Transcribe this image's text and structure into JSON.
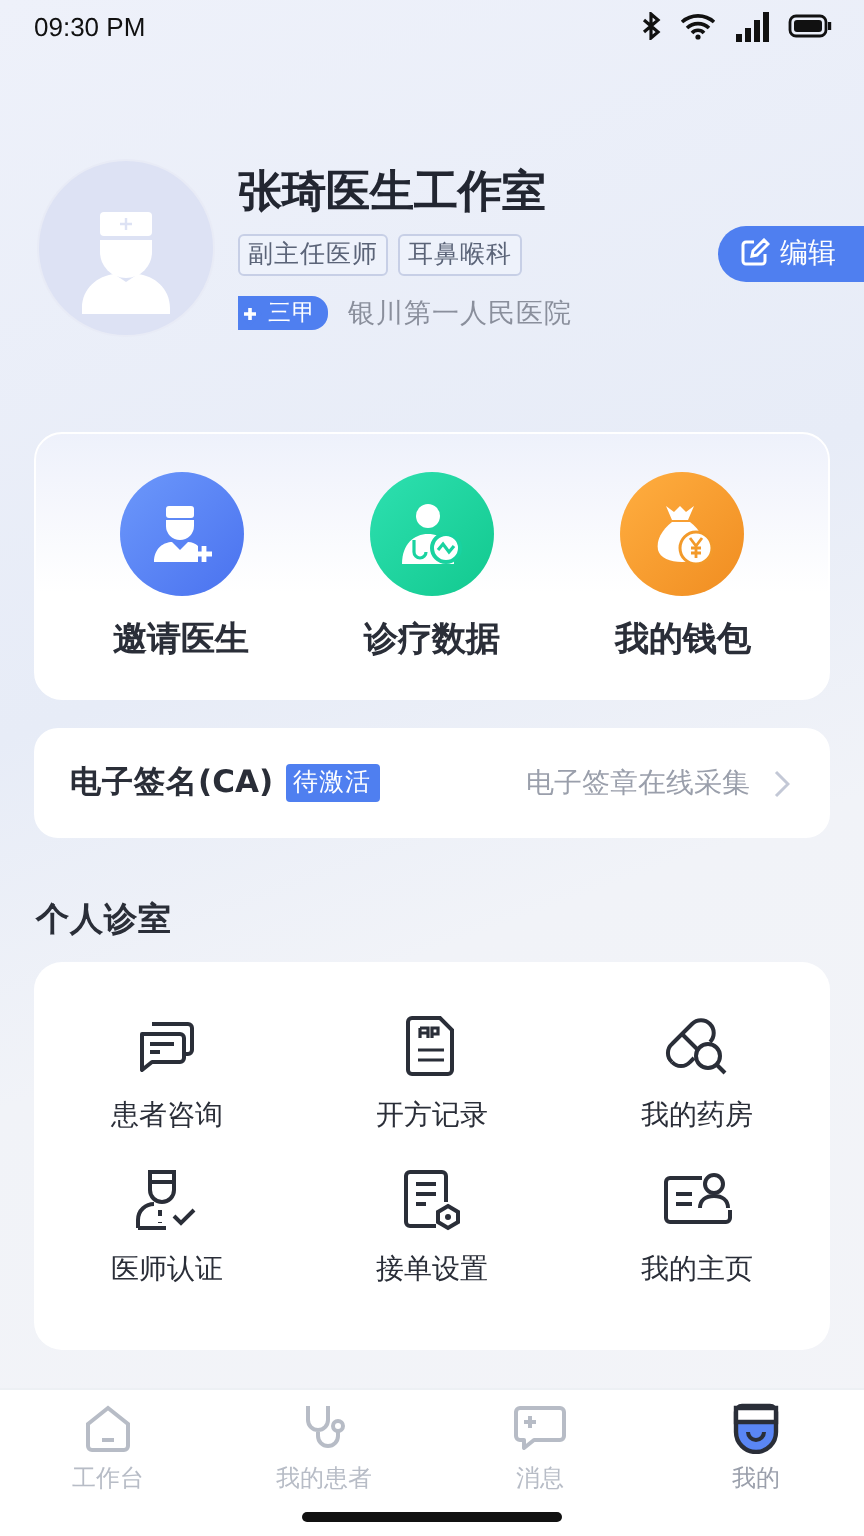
{
  "status_bar": {
    "time": "09:30 PM"
  },
  "profile": {
    "name": "张琦医生工作室",
    "tags": [
      "副主任医师",
      "耳鼻喉科"
    ],
    "level_badge": "三甲",
    "hospital": "银川第一人民医院",
    "edit_button": "编辑"
  },
  "quick_actions": [
    {
      "label": "邀请医生",
      "kind": "invite"
    },
    {
      "label": "诊疗数据",
      "kind": "data"
    },
    {
      "label": "我的钱包",
      "kind": "wallet"
    }
  ],
  "signature": {
    "title": "电子签名(CA)",
    "status": "待激活",
    "hint": "电子签章在线采集"
  },
  "clinic": {
    "title": "个人诊室",
    "items": [
      {
        "label": "患者咨询",
        "kind": "chat"
      },
      {
        "label": "开方记录",
        "kind": "rx"
      },
      {
        "label": "我的药房",
        "kind": "pharmacy"
      },
      {
        "label": "医师认证",
        "kind": "cert"
      },
      {
        "label": "接单设置",
        "kind": "settings"
      },
      {
        "label": "我的主页",
        "kind": "homepage"
      }
    ]
  },
  "tab_bar": [
    {
      "label": "工作台",
      "kind": "home",
      "selected": false
    },
    {
      "label": "我的患者",
      "kind": "patients",
      "selected": false
    },
    {
      "label": "消息",
      "kind": "messages",
      "selected": false
    },
    {
      "label": "我的",
      "kind": "me",
      "selected": true
    }
  ]
}
